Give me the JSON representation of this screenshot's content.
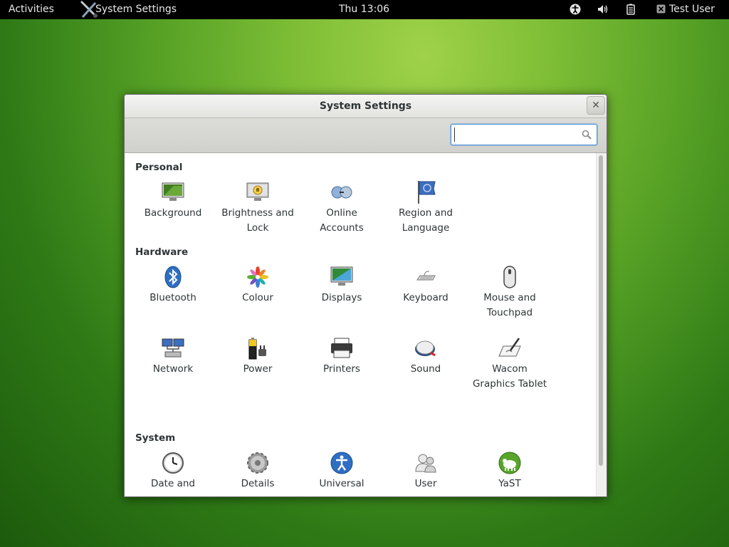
{
  "topbar": {
    "activities": "Activities",
    "app_name": "System Settings",
    "clock": "Thu 13:06",
    "user": "Test User",
    "icons": [
      "accessibility-icon",
      "volume-icon",
      "battery-icon",
      "user-status-icon"
    ]
  },
  "window": {
    "title": "System Settings",
    "close": "✕",
    "search_placeholder": ""
  },
  "sections": {
    "personal": {
      "title": "Personal",
      "items": [
        {
          "label": "Background",
          "icon": "background-icon"
        },
        {
          "label": "Brightness and Lock",
          "icon": "brightness-lock-icon"
        },
        {
          "label": "Online Accounts",
          "icon": "online-accounts-icon"
        },
        {
          "label": "Region and Language",
          "icon": "region-language-icon"
        }
      ]
    },
    "hardware": {
      "title": "Hardware",
      "items": [
        {
          "label": "Bluetooth",
          "icon": "bluetooth-icon"
        },
        {
          "label": "Colour",
          "icon": "colour-icon"
        },
        {
          "label": "Displays",
          "icon": "displays-icon"
        },
        {
          "label": "Keyboard",
          "icon": "keyboard-icon"
        },
        {
          "label": "Mouse and Touchpad",
          "icon": "mouse-icon"
        },
        {
          "label": "Network",
          "icon": "network-icon"
        },
        {
          "label": "Power",
          "icon": "power-icon"
        },
        {
          "label": "Printers",
          "icon": "printer-icon"
        },
        {
          "label": "Sound",
          "icon": "sound-icon"
        },
        {
          "label": "Wacom Graphics Tablet",
          "icon": "wacom-tablet-icon"
        }
      ]
    },
    "system": {
      "title": "System",
      "items": [
        {
          "label": "Date and",
          "icon": "clock-icon"
        },
        {
          "label": "Details",
          "icon": "details-gear-icon"
        },
        {
          "label": "Universal",
          "icon": "universal-access-icon"
        },
        {
          "label": "User",
          "icon": "users-icon"
        },
        {
          "label": "YaST",
          "icon": "yast-icon"
        }
      ]
    }
  },
  "colors": {
    "topbar_bg": "#000000",
    "accent_blue": "#4a90d9",
    "desktop_green": "#7dbd35"
  }
}
